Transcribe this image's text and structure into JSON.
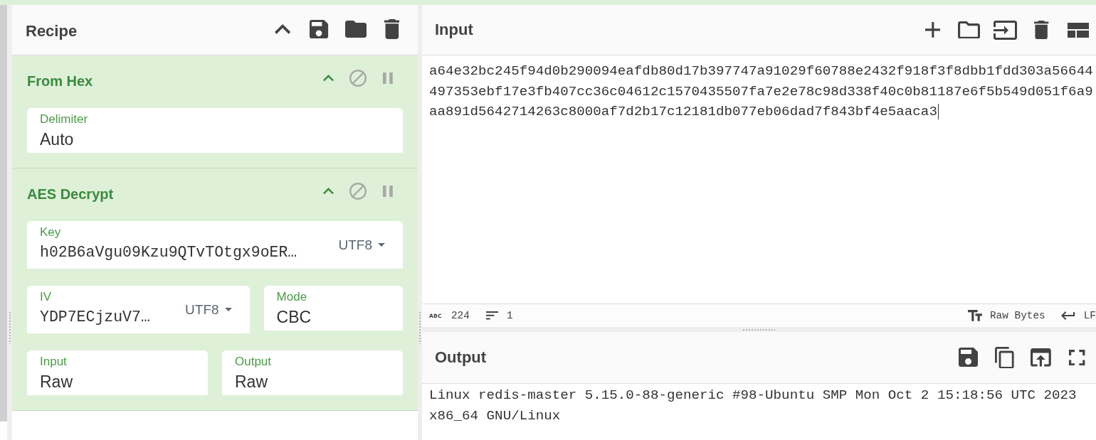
{
  "recipe": {
    "title": "Recipe",
    "operations": [
      {
        "name": "From Hex",
        "disabled": false,
        "breakpoint": false,
        "rows": [
          [
            {
              "kind": "choice",
              "label": "Delimiter",
              "value": "Auto"
            }
          ]
        ]
      },
      {
        "name": "AES Decrypt",
        "disabled": false,
        "breakpoint": false,
        "rows": [
          [
            {
              "kind": "string",
              "label": "Key",
              "value": "h02B6aVgu09Kzu9QTvTOtgx9oER…",
              "encoding": "UTF8"
            }
          ],
          [
            {
              "kind": "string",
              "label": "IV",
              "value": "YDP7ECjzuV7…",
              "encoding": "UTF8"
            },
            {
              "kind": "choice",
              "label": "Mode",
              "value": "CBC"
            }
          ],
          [
            {
              "kind": "choice",
              "label": "Input",
              "value": "Raw"
            },
            {
              "kind": "choice",
              "label": "Output",
              "value": "Raw"
            }
          ]
        ]
      }
    ]
  },
  "input": {
    "title": "Input",
    "text": "a64e32bc245f94d0b290094eafdb80d17b397747a91029f60788e2432f918f3f8dbb1fdd303a56644497353ebf17e3fb407cc36c04612c1570435507fa7e2e78c98d338f40c0b81187e6f5b549d051f6a9aa891d5642714263c8000af7d2b17c12181db077eb06dad7f843bf4e5aaca3",
    "status_bar": {
      "length_icon": "ABC",
      "length": "224",
      "lines": "1",
      "format": "Raw Bytes",
      "line_ending": "LF"
    }
  },
  "output": {
    "title": "Output",
    "text": "Linux redis-master 5.15.0-88-generic #98-Ubuntu SMP Mon Oct 2 15:18:56 UTC 2023 x86_64 GNU/Linux"
  }
}
